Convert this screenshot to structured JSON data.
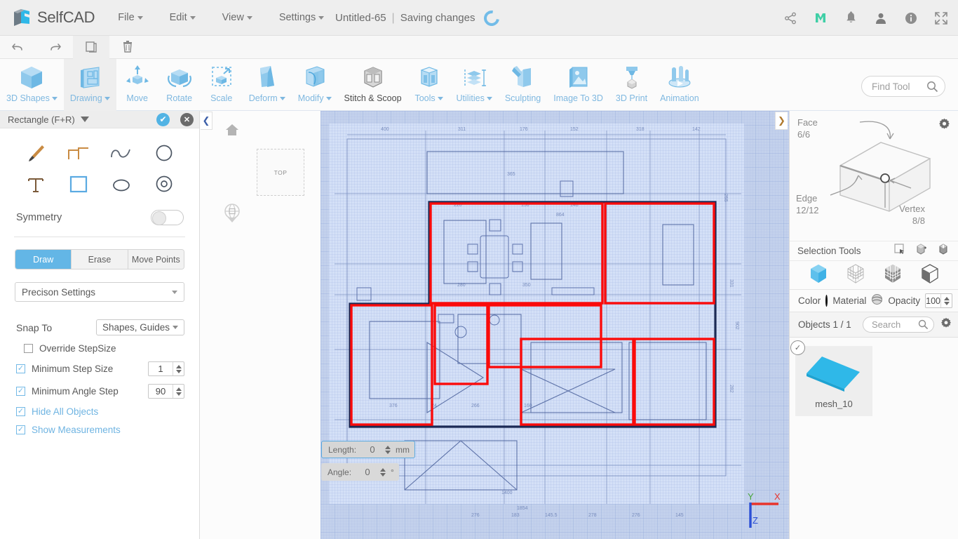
{
  "app": {
    "brand": "SelfCAD",
    "document_title": "Untitled-65",
    "separator": "|",
    "status": "Saving changes"
  },
  "menu": {
    "items": [
      {
        "label": "File",
        "has_caret": true
      },
      {
        "label": "Edit",
        "has_caret": true
      },
      {
        "label": "View",
        "has_caret": true
      },
      {
        "label": "Settings",
        "has_caret": true
      }
    ]
  },
  "top_right_icons": [
    {
      "name": "share-icon",
      "glyph": "➦"
    },
    {
      "name": "monetize-m-icon",
      "glyph": "M"
    },
    {
      "name": "notifications-bell-icon",
      "glyph": "🔔"
    },
    {
      "name": "user-account-icon",
      "glyph": "👤"
    },
    {
      "name": "info-icon",
      "glyph": "ⓘ"
    },
    {
      "name": "fullscreen-icon",
      "glyph": "⛶"
    }
  ],
  "quick_actions": [
    {
      "name": "undo-button",
      "glyph": "↶",
      "active": false
    },
    {
      "name": "redo-button",
      "glyph": "↷",
      "active": false
    },
    {
      "name": "copy-button",
      "glyph": "❐",
      "active": true
    },
    {
      "name": "delete-button",
      "glyph": "🗑",
      "active": false
    }
  ],
  "ribbon": {
    "items": [
      {
        "label": "3D Shapes",
        "caret": true,
        "selected": false,
        "dark": false
      },
      {
        "label": "Drawing",
        "caret": true,
        "selected": true,
        "dark": false
      },
      {
        "label": "Move",
        "caret": false,
        "selected": false,
        "dark": false
      },
      {
        "label": "Rotate",
        "caret": false,
        "selected": false,
        "dark": false
      },
      {
        "label": "Scale",
        "caret": false,
        "selected": false,
        "dark": false
      },
      {
        "label": "Deform",
        "caret": true,
        "selected": false,
        "dark": false
      },
      {
        "label": "Modify",
        "caret": true,
        "selected": false,
        "dark": false
      },
      {
        "label": "Stitch & Scoop",
        "caret": false,
        "selected": false,
        "dark": true
      },
      {
        "label": "Tools",
        "caret": true,
        "selected": false,
        "dark": false
      },
      {
        "label": "Utilities",
        "caret": true,
        "selected": false,
        "dark": false
      },
      {
        "label": "Sculpting",
        "caret": false,
        "selected": false,
        "dark": false
      },
      {
        "label": "Image To 3D",
        "caret": false,
        "selected": false,
        "dark": false
      },
      {
        "label": "3D Print",
        "caret": false,
        "selected": false,
        "dark": false
      },
      {
        "label": "Animation",
        "caret": false,
        "selected": false,
        "dark": false
      }
    ],
    "find_tool_placeholder": "Find Tool"
  },
  "left_panel": {
    "title": "Rectangle (F+R)",
    "confirm_glyph": "✔",
    "cancel_glyph": "✕",
    "shape_tools": [
      {
        "name": "brush-tool",
        "selected": false
      },
      {
        "name": "polyline-tool",
        "selected": false
      },
      {
        "name": "spline-tool",
        "selected": false
      },
      {
        "name": "circle-tool",
        "selected": false
      },
      {
        "name": "text-tool",
        "selected": false
      },
      {
        "name": "rectangle-tool",
        "selected": true
      },
      {
        "name": "ellipse-tool",
        "selected": false
      },
      {
        "name": "concentric-circle-tool",
        "selected": false
      }
    ],
    "symmetry_label": "Symmetry",
    "symmetry_on": false,
    "mode_buttons": [
      {
        "label": "Draw",
        "active": true
      },
      {
        "label": "Erase",
        "active": false
      },
      {
        "label": "Move Points",
        "active": false
      }
    ],
    "precision_settings_label": "Precison Settings",
    "snap_to_label": "Snap To",
    "snap_to_value": "Shapes, Guides",
    "options": [
      {
        "label": "Override StepSize",
        "checked": false,
        "blue": false,
        "value": null
      },
      {
        "label": "Minimum Step Size",
        "checked": true,
        "blue": false,
        "value": "1"
      },
      {
        "label": "Minimum Angle Step",
        "checked": true,
        "blue": false,
        "value": "90"
      },
      {
        "label": "Hide All Objects",
        "checked": true,
        "blue": true,
        "value": null
      },
      {
        "label": "Show Measurements",
        "checked": true,
        "blue": true,
        "value": null
      }
    ]
  },
  "viewport": {
    "view_cube_label": "TOP",
    "collapse_left_glyph": "❮",
    "collapse_right_glyph": "❯",
    "measurements": [
      {
        "label": "Length:",
        "value": "0",
        "unit": "mm",
        "highlighted": true
      },
      {
        "label": "Angle:",
        "value": "0",
        "unit": "°",
        "highlighted": false
      }
    ],
    "axis": {
      "x_label": "X",
      "y_label": "Y",
      "z_label": "Z",
      "x_color": "#e8342c",
      "y_color": "#49a53c",
      "z_color": "#2b4fd6"
    },
    "drawing_color": "#fb0b0b",
    "background_color": "#cdd9f0"
  },
  "right_panel": {
    "cube": {
      "face_label": "Face",
      "face_count": "6/6",
      "edge_label": "Edge",
      "edge_count": "12/12",
      "vertex_label": "Vertex",
      "vertex_count": "8/8"
    },
    "selection_tools_label": "Selection Tools",
    "selection_tool_icons": [
      {
        "name": "rectangle-select-icon"
      },
      {
        "name": "select-through-icon"
      },
      {
        "name": "select-linked-icon"
      }
    ],
    "selection_modes": [
      {
        "name": "object-mode-icon",
        "active": true
      },
      {
        "name": "vertex-mode-icon",
        "active": false
      },
      {
        "name": "face-mode-icon",
        "active": false
      },
      {
        "name": "edge-mode-icon",
        "active": false
      }
    ],
    "color_label": "Color",
    "color_value": "#111111",
    "material_label": "Material",
    "opacity_label": "Opacity",
    "opacity_value": "100",
    "objects_label": "Objects 1 / 1",
    "search_placeholder": "Search",
    "objects": [
      {
        "name": "mesh_10",
        "selected": true,
        "color": "#2fb8e8"
      }
    ]
  }
}
